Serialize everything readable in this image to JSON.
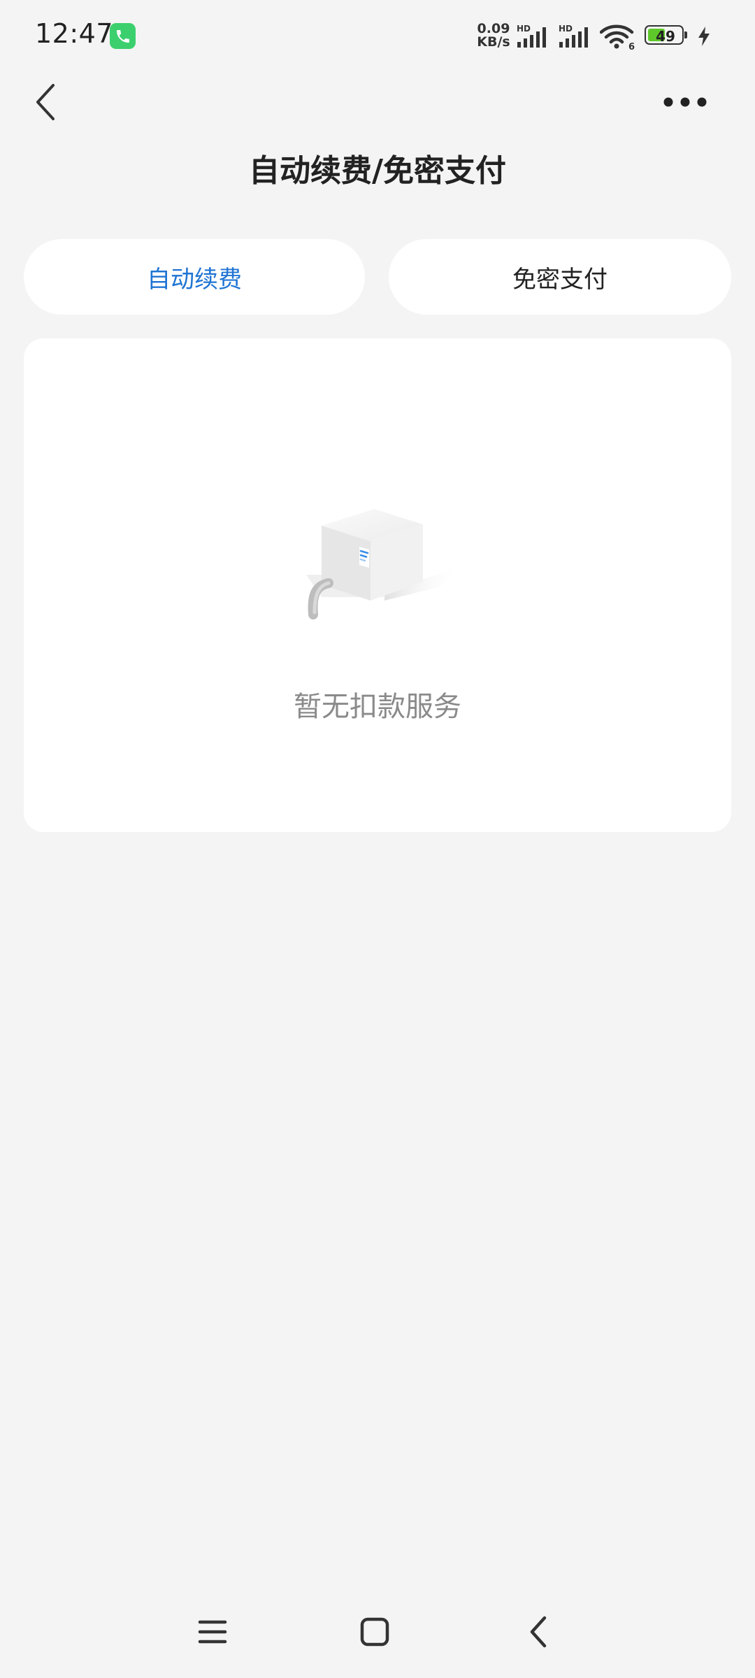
{
  "status_bar": {
    "time": "12:47",
    "net_speed_value": "0.09",
    "net_speed_unit": "KB/s",
    "signal1_label": "HD",
    "signal2_label": "HD",
    "wifi_badge": "6",
    "battery_level": "49"
  },
  "nav": {
    "title": "自动续费/免密支付"
  },
  "tabs": [
    {
      "label": "自动续费",
      "active": true
    },
    {
      "label": "免密支付",
      "active": false
    }
  ],
  "empty_state": {
    "message": "暂无扣款服务"
  },
  "colors": {
    "accent": "#1f74d3",
    "background": "#f4f4f4",
    "card": "#ffffff",
    "muted_text": "#8a8a8a"
  },
  "icons": {
    "back": "chevron-left-icon",
    "more": "more-horizontal-icon",
    "call": "phone-icon",
    "empty": "empty-box-illustration",
    "sys_menu": "menu-icon",
    "sys_home": "home-square-icon",
    "sys_back": "back-chevron-icon"
  }
}
